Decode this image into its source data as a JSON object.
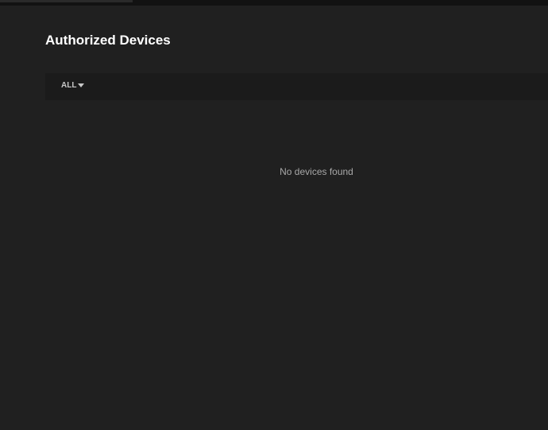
{
  "page": {
    "title": "Authorized Devices"
  },
  "filter": {
    "selected": "ALL",
    "icon": "caret-down-icon"
  },
  "empty_state": {
    "message": "No devices found"
  }
}
